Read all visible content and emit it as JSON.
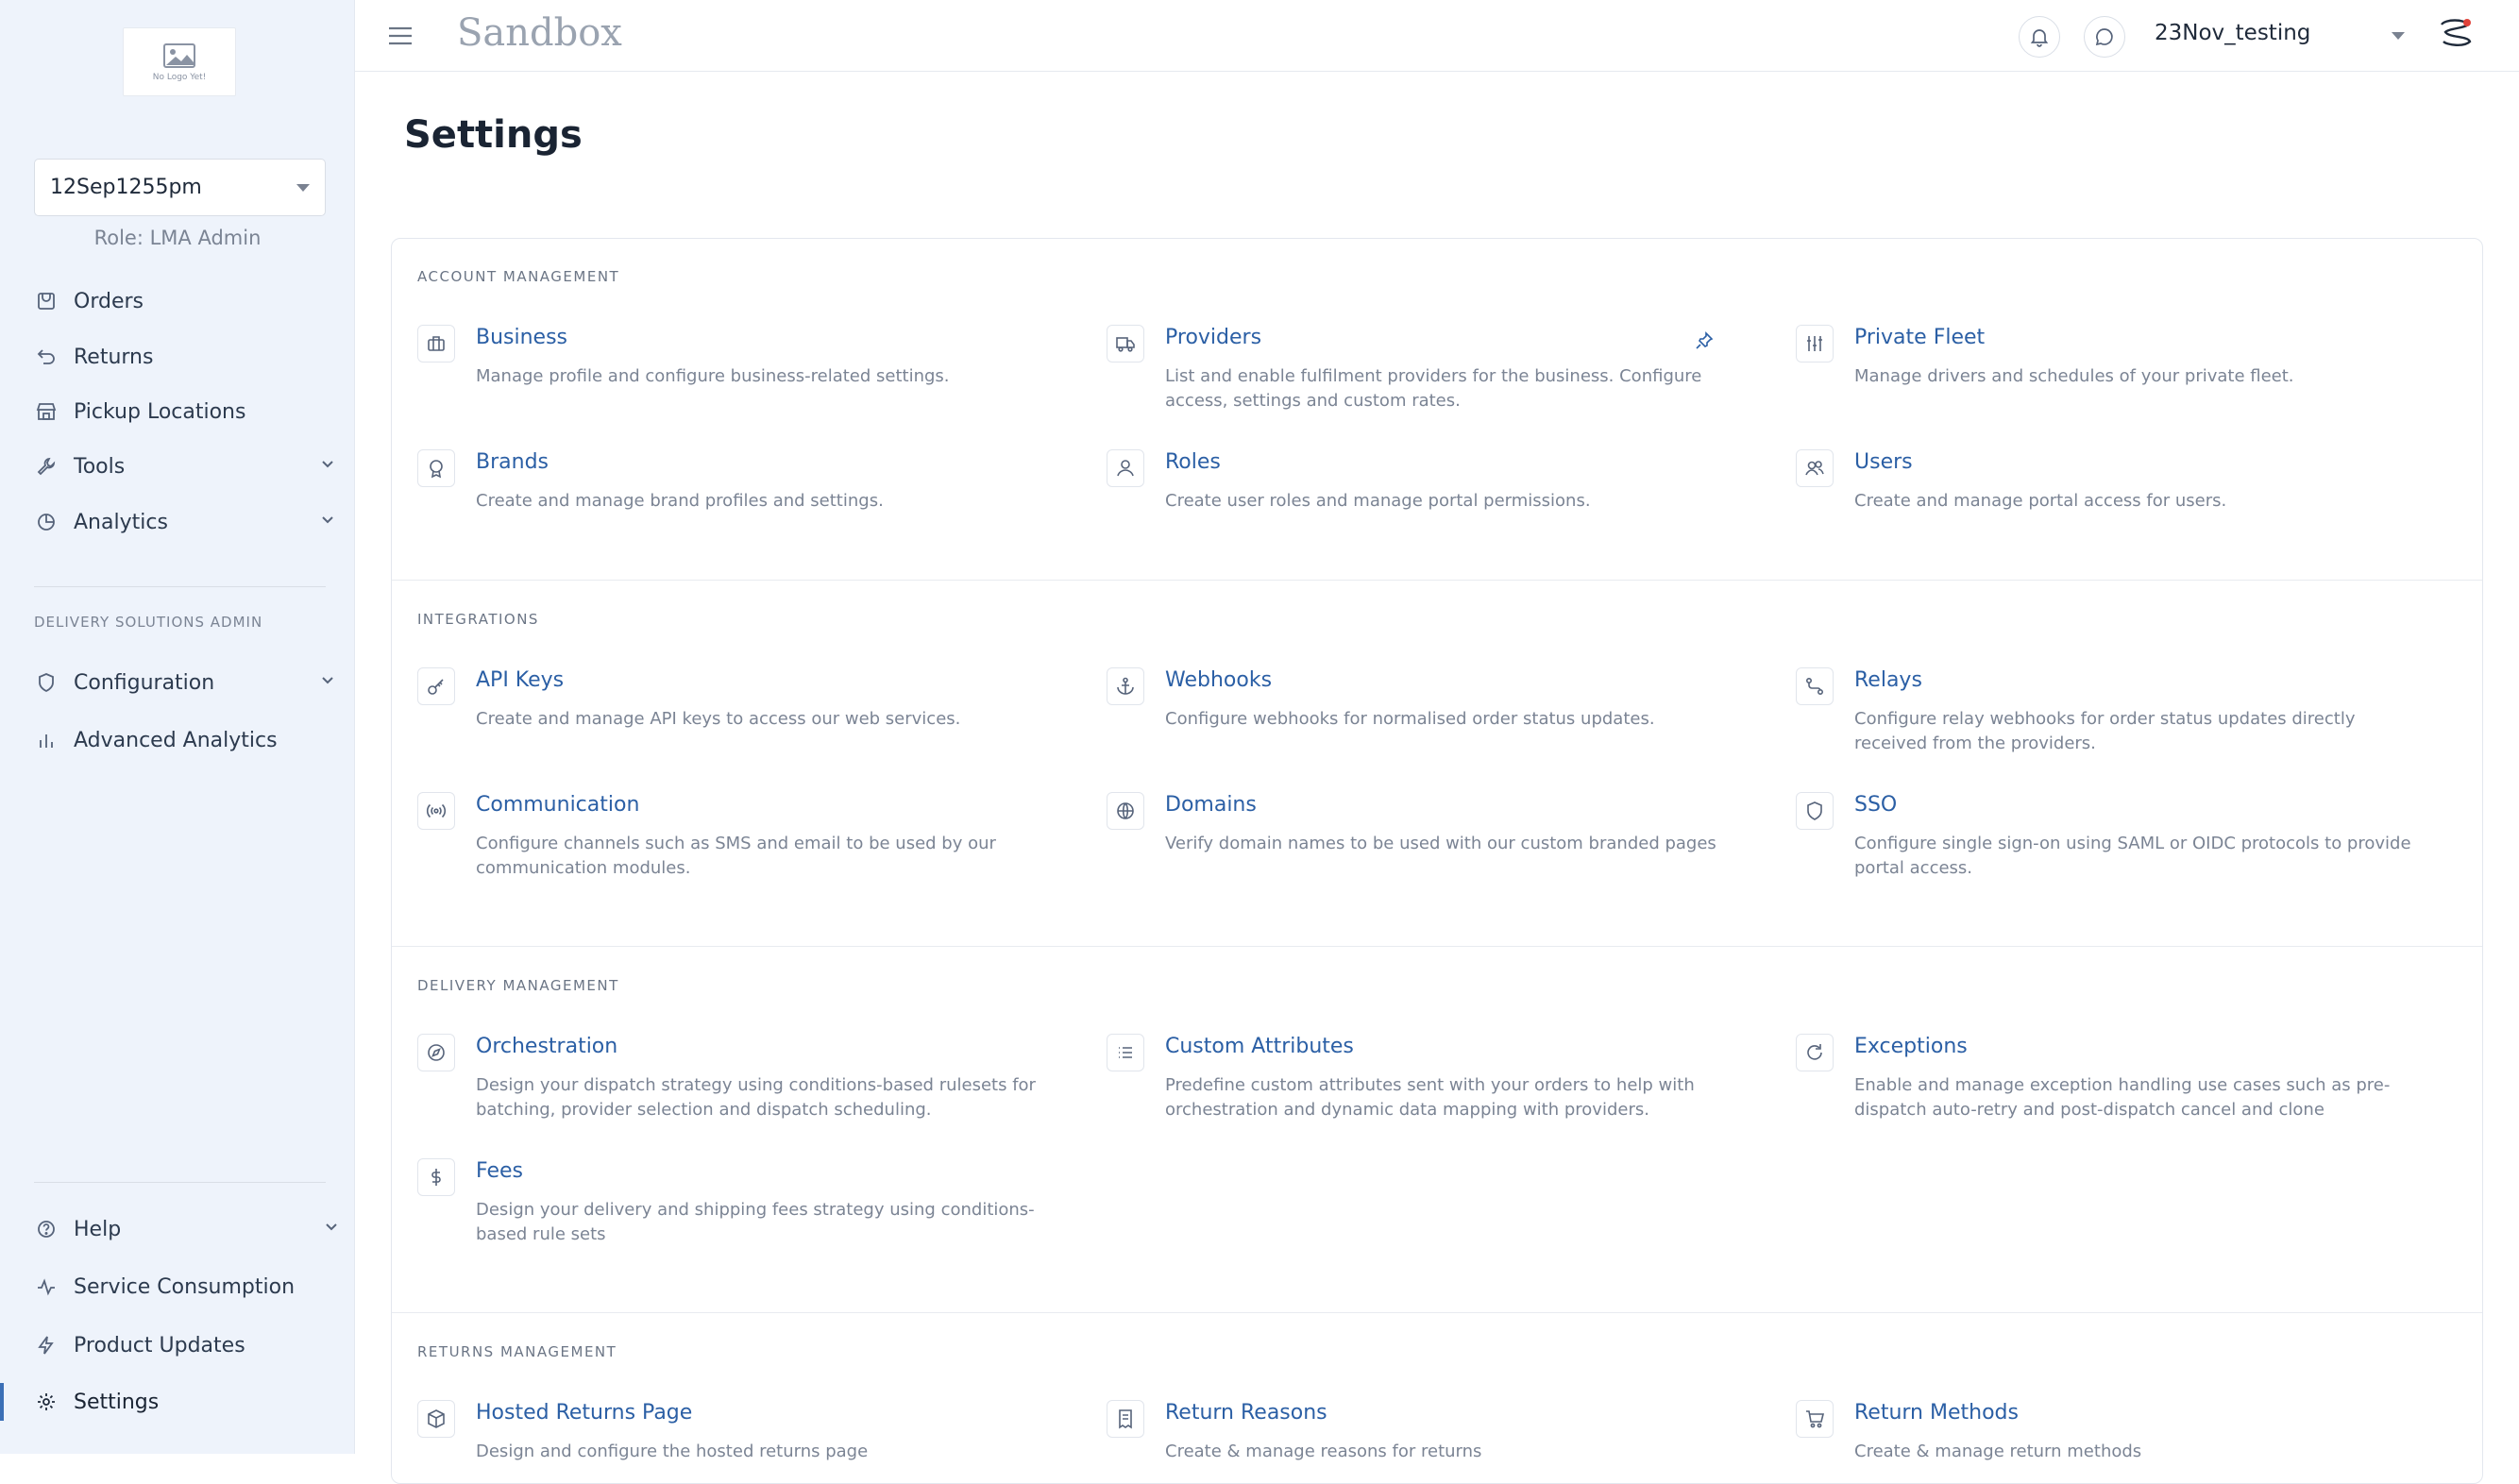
{
  "sidebar": {
    "logo_text": "No Logo Yet!",
    "tenant_select": "12Sep1255pm",
    "role": "Role: LMA Admin",
    "nav": [
      {
        "label": "Orders",
        "icon": "orders-icon"
      },
      {
        "label": "Returns",
        "icon": "returns-icon"
      },
      {
        "label": "Pickup Locations",
        "icon": "pickup-locations-icon"
      },
      {
        "label": "Tools",
        "icon": "tools-icon"
      },
      {
        "label": "Analytics",
        "icon": "analytics-icon"
      }
    ],
    "admin_section": "DELIVERY SOLUTIONS ADMIN",
    "admin_nav": [
      {
        "label": "Configuration",
        "icon": "configuration-icon"
      },
      {
        "label": "Advanced Analytics",
        "icon": "advanced-analytics-icon"
      }
    ],
    "bottom_nav": [
      {
        "label": "Help",
        "icon": "help-icon"
      },
      {
        "label": "Service Consumption",
        "icon": "service-consumption-icon"
      },
      {
        "label": "Product Updates",
        "icon": "product-updates-icon"
      },
      {
        "label": "Settings",
        "icon": "settings-icon"
      }
    ]
  },
  "topbar": {
    "title": "Sandbox",
    "org": "23Nov_testing"
  },
  "page": {
    "title": "Settings"
  },
  "sections": {
    "account": {
      "label": "ACCOUNT MANAGEMENT",
      "cards": [
        {
          "title": "Business",
          "desc": "Manage profile and configure business-related settings.",
          "icon": "business-icon"
        },
        {
          "title": "Providers",
          "desc": "List and enable fulfilment providers for the business. Configure access, settings and custom rates.",
          "icon": "truck-icon"
        },
        {
          "title": "Private Fleet",
          "desc": "Manage drivers and schedules of your private fleet.",
          "icon": "sliders-icon"
        },
        {
          "title": "Brands",
          "desc": "Create and manage brand profiles and settings.",
          "icon": "brand-badge-icon"
        },
        {
          "title": "Roles",
          "desc": "Create user roles and manage portal permissions.",
          "icon": "user-icon"
        },
        {
          "title": "Users",
          "desc": "Create and manage portal access for users.",
          "icon": "users-icon"
        }
      ]
    },
    "integrations": {
      "label": "INTEGRATIONS",
      "cards": [
        {
          "title": "API Keys",
          "desc": "Create and manage API keys to access our web services.",
          "icon": "key-icon"
        },
        {
          "title": "Webhooks",
          "desc": "Configure webhooks for normalised order status updates.",
          "icon": "anchor-icon"
        },
        {
          "title": "Relays",
          "desc": "Configure relay webhooks for order status updates directly received from the providers.",
          "icon": "route-icon"
        },
        {
          "title": "Communication",
          "desc": "Configure channels such as SMS and email to be used by our communication modules.",
          "icon": "broadcast-icon"
        },
        {
          "title": "Domains",
          "desc": "Verify domain names to be used with our custom branded pages",
          "icon": "globe-icon"
        },
        {
          "title": "SSO",
          "desc": "Configure single sign-on using SAML or OIDC protocols to provide portal access.",
          "icon": "shield-icon"
        }
      ]
    },
    "delivery": {
      "label": "DELIVERY MANAGEMENT",
      "cards": [
        {
          "title": "Orchestration",
          "desc": "Design your dispatch strategy using conditions-based rulesets for batching, provider selection and dispatch scheduling.",
          "icon": "compass-icon"
        },
        {
          "title": "Custom Attributes",
          "desc": "Predefine custom attributes sent with your orders to help with orchestration and dynamic data mapping with providers.",
          "icon": "list-icon"
        },
        {
          "title": "Exceptions",
          "desc": "Enable and manage exception handling use cases such as pre-dispatch auto-retry and post-dispatch cancel and clone",
          "icon": "refresh-icon"
        },
        {
          "title": "Fees",
          "desc": "Design your delivery and shipping fees strategy using conditions-based rule sets",
          "icon": "dollar-icon"
        }
      ]
    },
    "returns": {
      "label": "RETURNS MANAGEMENT",
      "cards": [
        {
          "title": "Hosted Returns Page",
          "desc": "Design and configure the hosted returns page",
          "icon": "package-icon"
        },
        {
          "title": "Return Reasons",
          "desc": "Create & manage reasons for returns",
          "icon": "receipt-icon"
        },
        {
          "title": "Return Methods",
          "desc": "Create & manage return methods",
          "icon": "cart-icon"
        }
      ]
    }
  }
}
